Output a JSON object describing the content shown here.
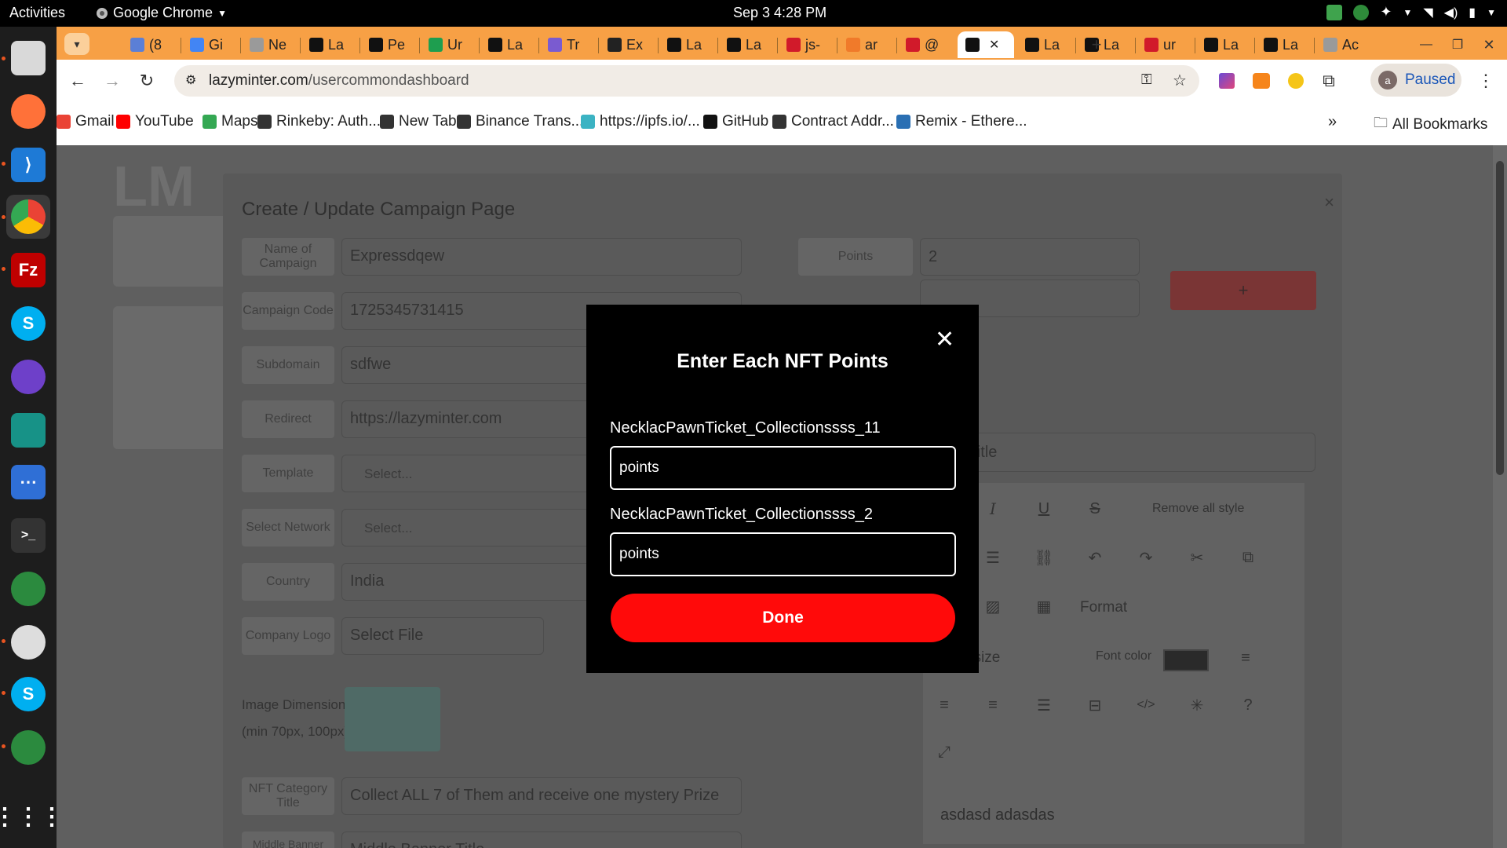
{
  "system": {
    "activities": "Activities",
    "app_name": "Google Chrome",
    "clock": "Sep 3  4:28 PM"
  },
  "browser": {
    "tabs": [
      {
        "label": "(8",
        "color": "#5b7fd6"
      },
      {
        "label": "Gi",
        "color": "#4285f4"
      },
      {
        "label": "Ne",
        "color": "#9a9a9a"
      },
      {
        "label": "La",
        "color": "#111111"
      },
      {
        "label": "Pe",
        "color": "#111111"
      },
      {
        "label": "Ur",
        "color": "#1e9e4f"
      },
      {
        "label": "La",
        "color": "#111111"
      },
      {
        "label": "Tr",
        "color": "#7a5bd0"
      },
      {
        "label": "Ex",
        "color": "#222222"
      },
      {
        "label": "La",
        "color": "#111111"
      },
      {
        "label": "La",
        "color": "#111111"
      },
      {
        "label": "js-",
        "color": "#d11a2a"
      },
      {
        "label": "ar",
        "color": "#f07a2a"
      },
      {
        "label": "@",
        "color": "#d11a2a"
      },
      {
        "label": "",
        "color": "#111111",
        "active": true
      },
      {
        "label": "La",
        "color": "#111111"
      },
      {
        "label": "La",
        "color": "#111111"
      },
      {
        "label": "ur",
        "color": "#d11a2a"
      },
      {
        "label": "La",
        "color": "#111111"
      },
      {
        "label": "La",
        "color": "#111111"
      },
      {
        "label": "Ac",
        "color": "#9a9a9a"
      }
    ],
    "url_host": "lazyminter.com",
    "url_path": "/usercommondashboard",
    "profile_initial": "a",
    "profile_status": "Paused",
    "bookmarks": [
      {
        "label": "Gmail",
        "color": "#ea4335"
      },
      {
        "label": "YouTube",
        "color": "#ff0000"
      },
      {
        "label": "Maps",
        "color": "#34a853"
      },
      {
        "label": "Rinkeby: Auth...",
        "color": "#333333"
      },
      {
        "label": "New Tab",
        "color": "#333333"
      },
      {
        "label": "Binance Trans...",
        "color": "#333333"
      },
      {
        "label": "https://ipfs.io/...",
        "color": "#3bb3c3"
      },
      {
        "label": "GitHub",
        "color": "#111111"
      },
      {
        "label": "Contract Addr...",
        "color": "#333333"
      },
      {
        "label": "Remix - Ethere...",
        "color": "#2a6fb3"
      }
    ],
    "all_bookmarks": "All Bookmarks",
    "more_bookmarks": "»"
  },
  "panel": {
    "title": "Create / Update Campaign Page",
    "close": "×",
    "fields": [
      {
        "label": "Name of Campaign",
        "value": "Expressdqew"
      },
      {
        "label": "Campaign Code",
        "value": "1725345731415"
      },
      {
        "label": "Subdomain",
        "value": "sdfwe"
      },
      {
        "label": "Redirect",
        "value": "https://lazyminter.com"
      },
      {
        "label": "Template",
        "value": "Select..."
      },
      {
        "label": "Select Network",
        "value": "Select..."
      },
      {
        "label": "Country",
        "value": "India"
      },
      {
        "label": "Company Logo",
        "value": "Select File"
      }
    ],
    "image_dimension": "Image Dimension",
    "image_dimension_hint": "(min 70px, 100px)",
    "nft_category_label": "NFT Category Title",
    "nft_category_value": "Collect ALL 7 of Them  and receive one mystery Prize",
    "middle_banner_label": "Middle Banner Title",
    "middle_banner_value": "Middle Banner Title",
    "points_label": "Points",
    "points_value": "2",
    "plus_label": "+",
    "banner_placeholder": "anner Title",
    "editor": {
      "italic": "I",
      "underline": "U",
      "strike": "S",
      "remove_style": "Remove all style",
      "format": "Format",
      "font_size": "t size",
      "font_color": "Font color",
      "help": "?",
      "content": "asdasd adasdas"
    }
  },
  "modal": {
    "title": "Enter Each NFT Points",
    "close": "✕",
    "items": [
      {
        "label": "NecklacPawnTicket_Collectionssss_11",
        "placeholder": "points"
      },
      {
        "label": "NecklacPawnTicket_Collectionssss_2",
        "placeholder": "points"
      }
    ],
    "done": "Done"
  }
}
